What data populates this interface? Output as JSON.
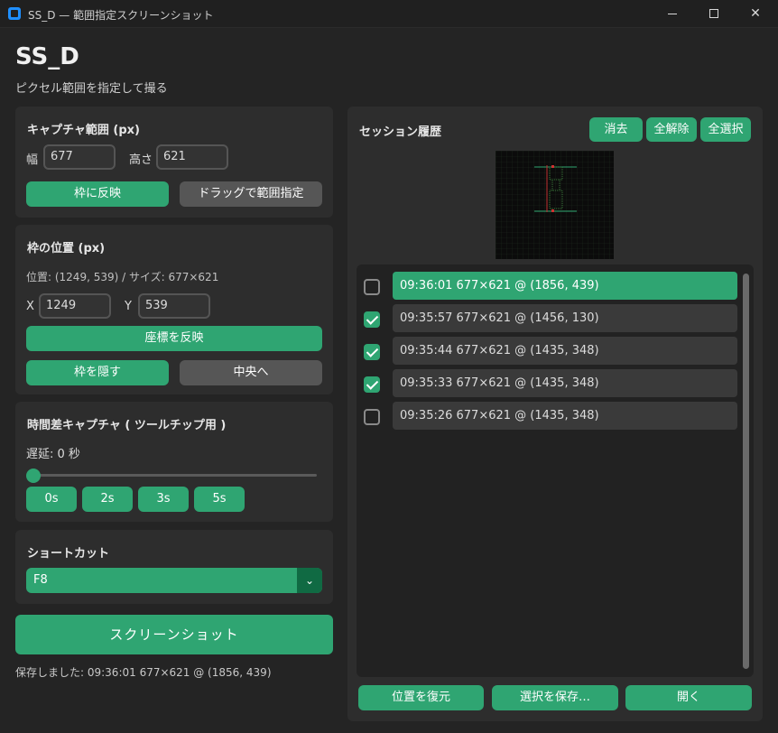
{
  "window": {
    "title": "SS_D — 範囲指定スクリーンショット"
  },
  "header": {
    "title": "SS_D",
    "subtitle": "ピクセル範囲を指定して撮る"
  },
  "capture_range": {
    "title": "キャプチャ範囲 (px)",
    "width_label": "幅",
    "width_value": "677",
    "height_label": "高さ",
    "height_value": "621",
    "apply_label": "枠に反映",
    "drag_label": "ドラッグで範囲指定"
  },
  "frame_pos": {
    "title": "枠の位置 (px)",
    "info": "位置: (1249, 539)  /  サイズ: 677×621",
    "x_label": "X",
    "x_value": "1249",
    "y_label": "Y",
    "y_value": "539",
    "apply_coords_label": "座標を反映",
    "hide_label": "枠を隠す",
    "center_label": "中央へ"
  },
  "delay": {
    "title": "時間差キャプチャ ( ツールチップ用 )",
    "value_text": "遅延: 0 秒",
    "value": 0,
    "presets": [
      "0s",
      "2s",
      "3s",
      "5s"
    ]
  },
  "shortcut": {
    "title": "ショートカット",
    "value": "F8"
  },
  "screenshot_button": "スクリーンショット",
  "status": "保存しました: 09:36:01  677×621  @ (1856, 439)",
  "history": {
    "title": "セッション履歴",
    "clear_label": "消去",
    "deselect_all_label": "全解除",
    "select_all_label": "全選択",
    "items": [
      {
        "text": "09:36:01  677×621  @ (1856, 439)",
        "checked": false,
        "selected": true
      },
      {
        "text": "09:35:57  677×621  @ (1456, 130)",
        "checked": true,
        "selected": false
      },
      {
        "text": "09:35:44  677×621  @ (1435, 348)",
        "checked": true,
        "selected": false
      },
      {
        "text": "09:35:33  677×621  @ (1435, 348)",
        "checked": true,
        "selected": false
      },
      {
        "text": "09:35:26  677×621  @ (1435, 348)",
        "checked": false,
        "selected": false
      }
    ],
    "restore_label": "位置を復元",
    "save_selected_label": "選択を保存…",
    "open_label": "開く"
  },
  "colors": {
    "accent": "#2fa572",
    "accent_dark": "#106a43",
    "bg": "#242424",
    "card": "#2d2d2d",
    "gray_button": "#565656"
  }
}
